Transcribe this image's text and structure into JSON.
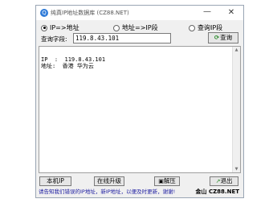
{
  "window": {
    "title": "纯真IP地址数据库 (CZ88.NET)",
    "minimize": "—",
    "close": "✕"
  },
  "modes": [
    {
      "label": "IP=>地址",
      "selected": true
    },
    {
      "label": "地址=>IP段",
      "selected": false
    },
    {
      "label": "查询IP段",
      "selected": false
    }
  ],
  "query": {
    "label": "查询字段:",
    "value": "119.8.43.101",
    "button": "查询"
  },
  "result": {
    "line1": "IP  :  119.8.43.101",
    "line2": "地址:  香港 华为云"
  },
  "buttons": {
    "local_ip": "本机IP",
    "online_update": "在线升级",
    "extract": "解压",
    "exit": "退出"
  },
  "status": {
    "notice": "请告知我们错误的IP地址，新IP地址，以便及时更新，谢谢!",
    "brand": "金山 CZ88.NET"
  }
}
